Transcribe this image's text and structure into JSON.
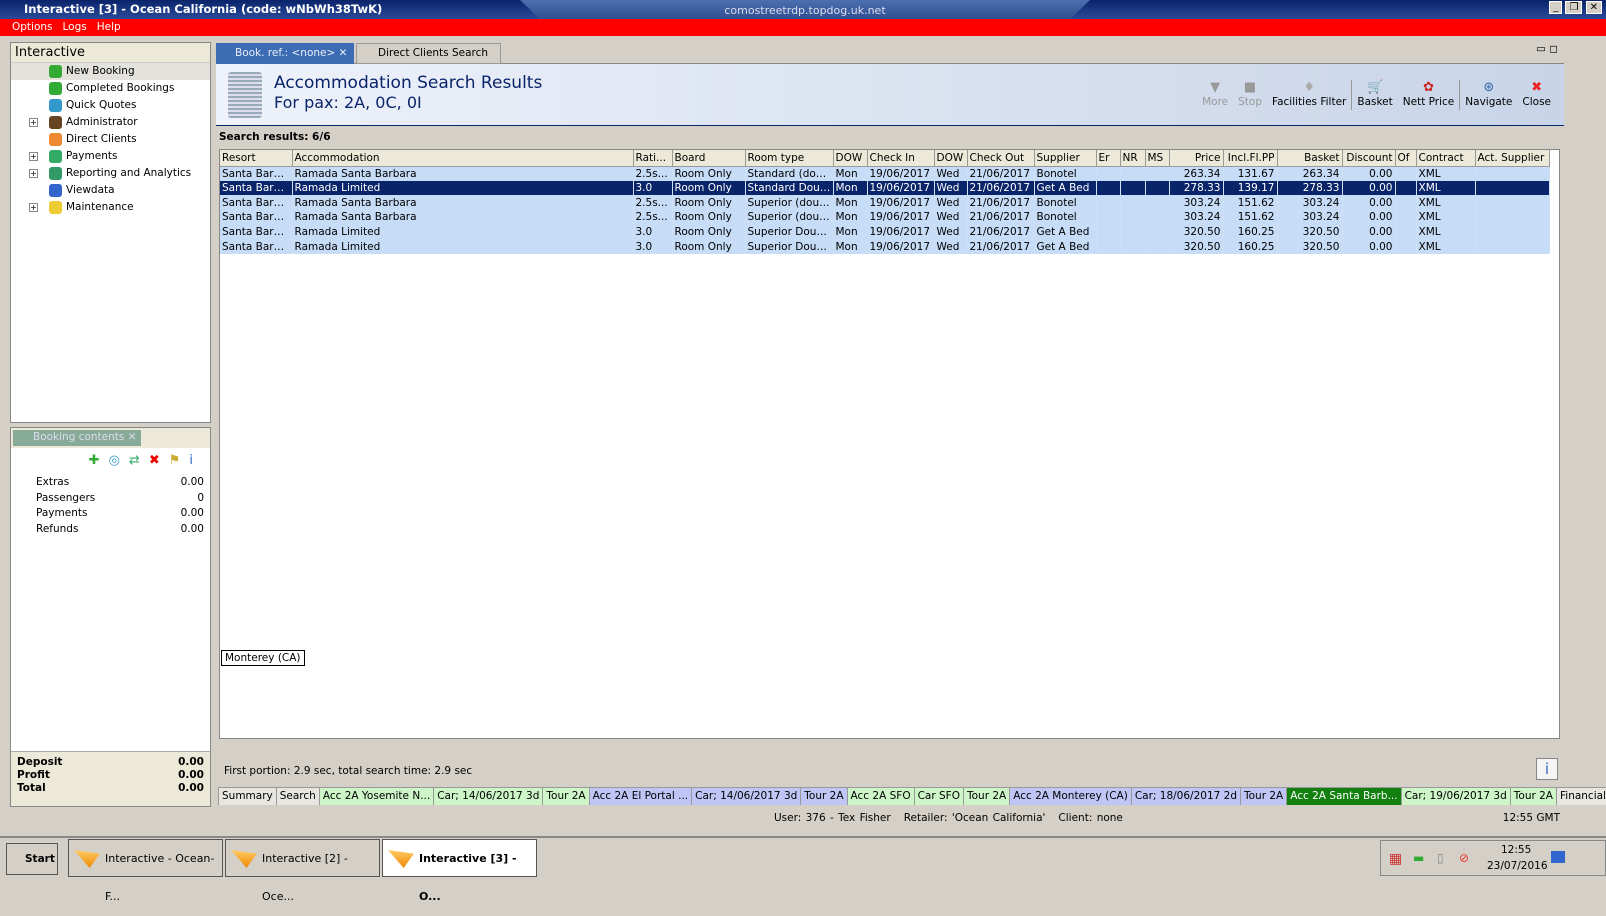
{
  "window": {
    "title": "Interactive [3] - Ocean California (code: wNbWh38TwK)",
    "rdp_host": "comostreetrdp.topdog.uk.net"
  },
  "menu": [
    "Options",
    "Logs",
    "Help"
  ],
  "nav": {
    "title": "Interactive",
    "items": [
      {
        "label": "New Booking",
        "expand": false,
        "color": "#3a3"
      },
      {
        "label": "Completed Bookings",
        "expand": false,
        "color": "#3a3"
      },
      {
        "label": "Quick Quotes",
        "expand": false,
        "color": "#39c"
      },
      {
        "label": "Administrator",
        "expand": true,
        "color": "#642"
      },
      {
        "label": "Direct Clients",
        "expand": false,
        "color": "#e83"
      },
      {
        "label": "Payments",
        "expand": true,
        "color": "#3a6"
      },
      {
        "label": "Reporting and Analytics",
        "expand": true,
        "color": "#396"
      },
      {
        "label": "Viewdata",
        "expand": false,
        "color": "#36c"
      },
      {
        "label": "Maintenance",
        "expand": true,
        "color": "#ec3"
      }
    ]
  },
  "booking": {
    "title": "Booking contents",
    "rows": [
      {
        "label": "Extras",
        "value": "0.00"
      },
      {
        "label": "Passengers",
        "value": "0"
      },
      {
        "label": "Payments",
        "value": "0.00"
      },
      {
        "label": "Refunds",
        "value": "0.00"
      }
    ],
    "totals": [
      {
        "label": "Deposit",
        "value": "0.00"
      },
      {
        "label": "Profit",
        "value": "0.00"
      },
      {
        "label": "Total",
        "value": "0.00"
      }
    ]
  },
  "tabs": [
    {
      "label": "Book. ref.: <none>",
      "active": true
    },
    {
      "label": "Direct Clients Search",
      "active": false
    }
  ],
  "header": {
    "title": "Accommodation Search Results",
    "subtitle": "For pax: 2A, 0C, 0I"
  },
  "toolbar": [
    {
      "label": "More",
      "icon": "triangle-down",
      "disabled": true
    },
    {
      "label": "Stop",
      "icon": "stop",
      "disabled": true
    },
    {
      "label": "Facilities Filter",
      "icon": "filter",
      "disabled": false
    },
    {
      "label": "Basket",
      "icon": "basket",
      "disabled": false
    },
    {
      "label": "Nett Price",
      "icon": "price",
      "disabled": false
    },
    {
      "label": "Navigate",
      "icon": "compass",
      "disabled": false
    },
    {
      "label": "Close",
      "icon": "close",
      "disabled": false
    }
  ],
  "results": {
    "count_label": "Search results: 6/6",
    "columns": [
      "Resort",
      "Accommodation",
      "Rati...",
      "Board",
      "Room type",
      "DOW",
      "Check In",
      "DOW",
      "Check Out",
      "Supplier",
      "Er",
      "NR",
      "MS",
      "Price",
      "Incl.Fl.PP",
      "Basket",
      "Discount",
      "Of",
      "Contract",
      "Act. Supplier"
    ],
    "rows": [
      [
        "Santa Barb...",
        "Ramada Santa Barbara",
        "2.5s...",
        "Room Only",
        "Standard (dou...",
        "Mon",
        "19/06/2017",
        "Wed",
        "21/06/2017",
        "Bonotel",
        "",
        "",
        "",
        "263.34",
        "131.67",
        "263.34",
        "0.00",
        "",
        "XML",
        ""
      ],
      [
        "Santa Barb...",
        "Ramada Limited",
        "3.0",
        "Room Only",
        "Standard Double",
        "Mon",
        "19/06/2017",
        "Wed",
        "21/06/2017",
        "Get A Bed",
        "",
        "",
        "",
        "278.33",
        "139.17",
        "278.33",
        "0.00",
        "",
        "XML",
        ""
      ],
      [
        "Santa Barb...",
        "Ramada Santa Barbara",
        "2.5s...",
        "Room Only",
        "Superior (double)",
        "Mon",
        "19/06/2017",
        "Wed",
        "21/06/2017",
        "Bonotel",
        "",
        "",
        "",
        "303.24",
        "151.62",
        "303.24",
        "0.00",
        "",
        "XML",
        ""
      ],
      [
        "Santa Barb...",
        "Ramada Santa Barbara",
        "2.5s...",
        "Room Only",
        "Superior (doub...",
        "Mon",
        "19/06/2017",
        "Wed",
        "21/06/2017",
        "Bonotel",
        "",
        "",
        "",
        "303.24",
        "151.62",
        "303.24",
        "0.00",
        "",
        "XML",
        ""
      ],
      [
        "Santa Barb...",
        "Ramada Limited",
        "3.0",
        "Room Only",
        "Superior Double",
        "Mon",
        "19/06/2017",
        "Wed",
        "21/06/2017",
        "Get A Bed",
        "",
        "",
        "",
        "320.50",
        "160.25",
        "320.50",
        "0.00",
        "",
        "XML",
        ""
      ],
      [
        "Santa Barb...",
        "Ramada Limited",
        "3.0",
        "Room Only",
        "Superior Doubl...",
        "Mon",
        "19/06/2017",
        "Wed",
        "21/06/2017",
        "Get A Bed",
        "",
        "",
        "",
        "320.50",
        "160.25",
        "320.50",
        "0.00",
        "",
        "XML",
        ""
      ]
    ],
    "selected_row": 1,
    "tooltip": "Monterey (CA)",
    "timing": "First portion: 2.9 sec, total search time: 2.9 sec"
  },
  "bottom_tabs": [
    {
      "label": "Summary",
      "c": "p"
    },
    {
      "label": "Search",
      "c": "p"
    },
    {
      "label": "Acc 2A Yosemite N...",
      "c": "g"
    },
    {
      "label": "Car; 14/06/2017 3d",
      "c": "g"
    },
    {
      "label": "Tour 2A",
      "c": "g"
    },
    {
      "label": "Acc 2A El Portal ...",
      "c": "b"
    },
    {
      "label": "Car; 14/06/2017 3d",
      "c": "b"
    },
    {
      "label": "Tour 2A",
      "c": "b"
    },
    {
      "label": "Acc 2A SFO",
      "c": "g"
    },
    {
      "label": "Car SFO",
      "c": "g"
    },
    {
      "label": "Tour 2A",
      "c": "g"
    },
    {
      "label": "Acc 2A Monterey (CA)",
      "c": "b"
    },
    {
      "label": "Car; 18/06/2017 2d",
      "c": "b"
    },
    {
      "label": "Tour 2A",
      "c": "b"
    },
    {
      "label": "Acc 2A Santa Barb...",
      "c": "dg"
    },
    {
      "label": "Car; 19/06/2017 3d",
      "c": "g"
    },
    {
      "label": "Tour 2A",
      "c": "g"
    },
    {
      "label": "Financial Summary",
      "c": "p"
    }
  ],
  "status": {
    "user": "User: 376 - Tex Fisher",
    "retailer": "Retailer: 'Ocean California'",
    "client": "Client: none",
    "time": "12:55 GMT"
  },
  "taskbar": {
    "start": "Start",
    "tasks": [
      "Interactive - Ocean-F...",
      "Interactive [2] - Oce...",
      "Interactive [3] - O..."
    ],
    "clock_time": "12:55",
    "clock_date": "23/07/2016"
  }
}
